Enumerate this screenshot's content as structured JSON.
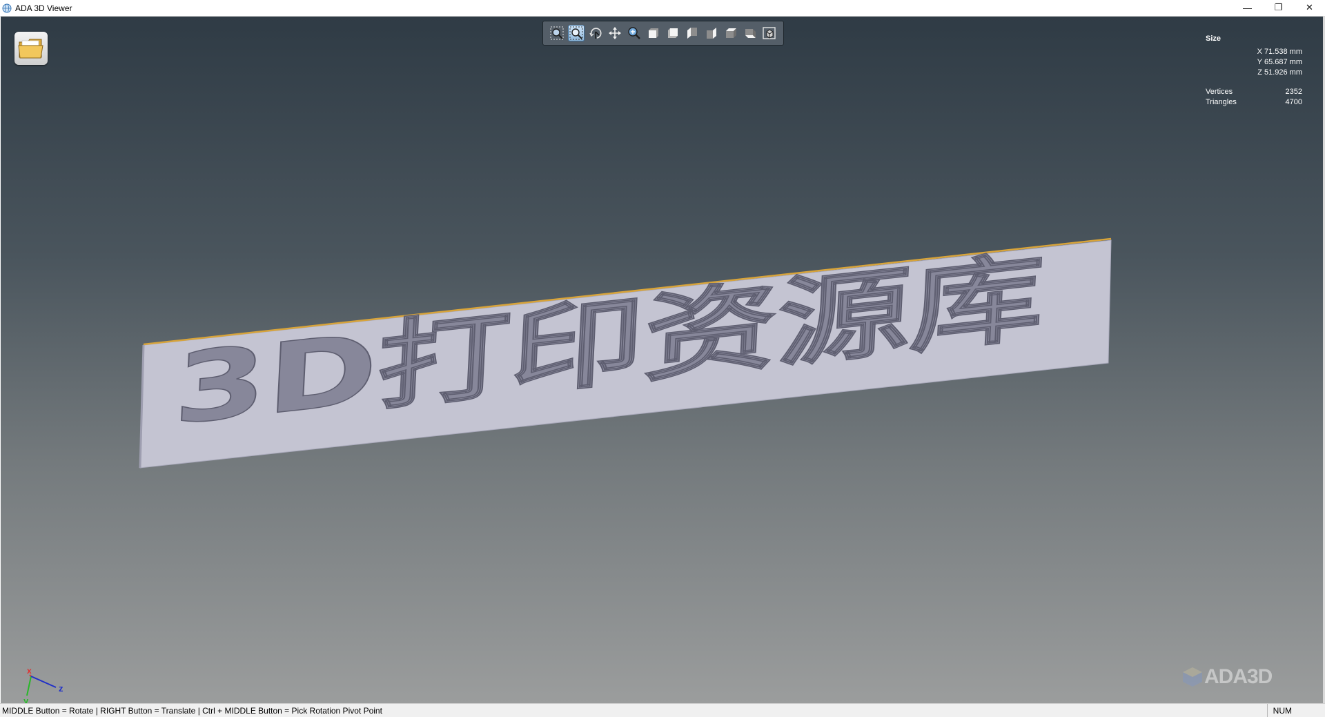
{
  "window": {
    "title": "ADA 3D Viewer",
    "controls": {
      "minimize": "—",
      "restore": "❐",
      "close": "✕"
    }
  },
  "toolbar": {
    "buttons": [
      {
        "icon": "zoom-extents-icon",
        "active": false
      },
      {
        "icon": "zoom-window-icon",
        "active": true
      },
      {
        "icon": "rotate-icon",
        "active": false
      },
      {
        "icon": "pan-icon",
        "active": false
      },
      {
        "icon": "zoom-icon",
        "active": false
      },
      {
        "icon": "view-front-icon",
        "active": false
      },
      {
        "icon": "view-back-icon",
        "active": false
      },
      {
        "icon": "view-left-icon",
        "active": false
      },
      {
        "icon": "view-right-icon",
        "active": false
      },
      {
        "icon": "view-top-icon",
        "active": false
      },
      {
        "icon": "view-bottom-icon",
        "active": false
      },
      {
        "icon": "view-iso-icon",
        "active": false
      }
    ]
  },
  "info": {
    "size_label": "Size",
    "x": "X 71.538 mm",
    "y": "Y 65.687 mm",
    "z": "Z 51.926 mm",
    "vertices_label": "Vertices",
    "vertices_value": "2352",
    "triangles_label": "Triangles",
    "triangles_value": "4700"
  },
  "model": {
    "text": "3D打印资源库",
    "plate_color": "#c4c4d2",
    "edge_color": "#d8a43a"
  },
  "axes": {
    "x": "x",
    "y": "y",
    "z": "z"
  },
  "watermark": "ADA3D",
  "status": {
    "hint": "MIDDLE Button = Rotate | RIGHT Button = Translate | Ctrl + MIDDLE Button = Pick Rotation Pivot Point",
    "num": "NUM"
  }
}
